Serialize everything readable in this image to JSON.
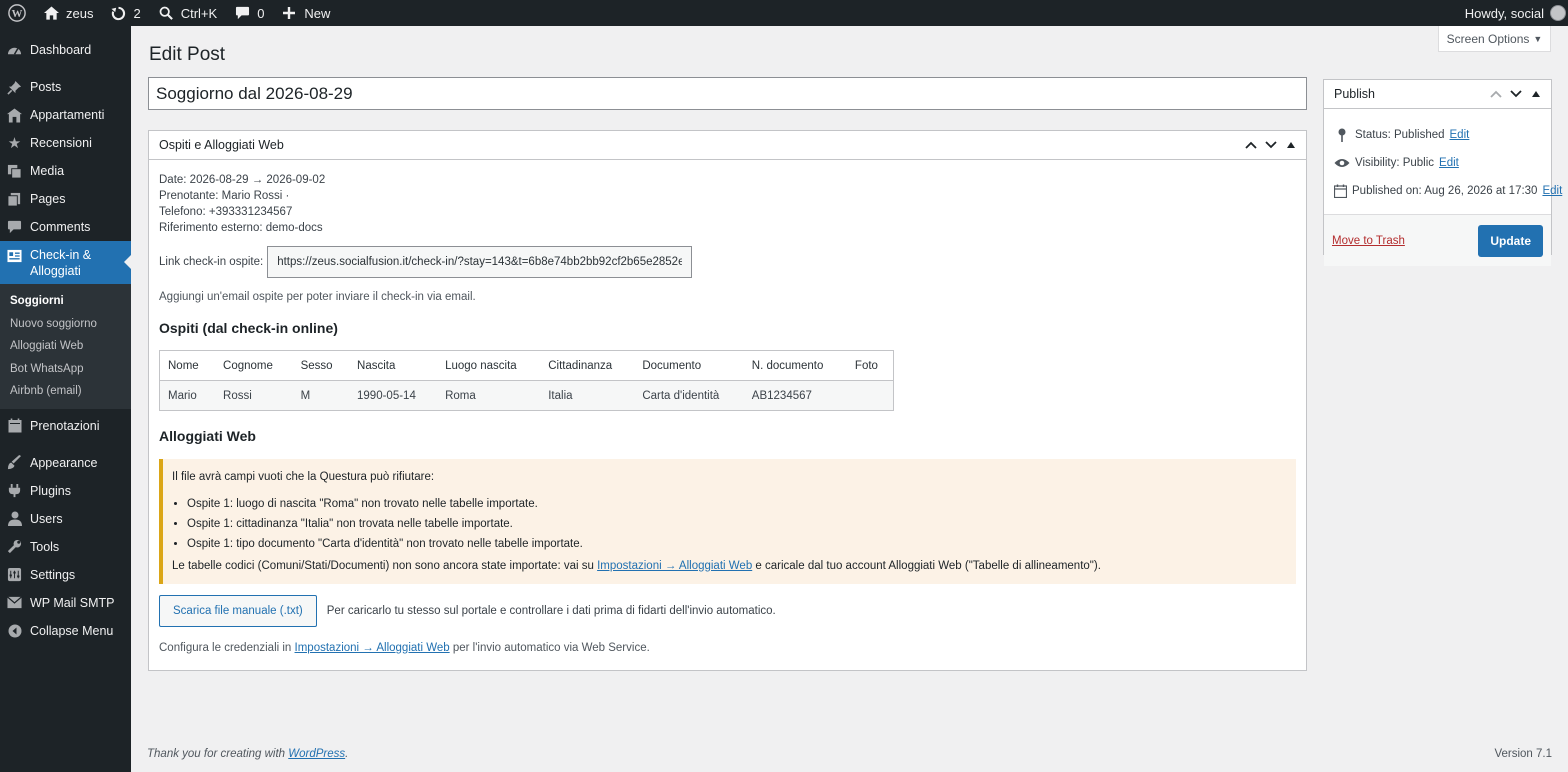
{
  "adminbar": {
    "site_name": "zeus",
    "updates_count": "2",
    "search_shortcut": "Ctrl+K",
    "comments_count": "0",
    "new_label": "New",
    "howdy": "Howdy, social"
  },
  "sidebar": {
    "items": [
      {
        "label": "Dashboard",
        "icon": "dashboard-icon"
      },
      {
        "label": "Posts",
        "icon": "pin-icon"
      },
      {
        "label": "Appartamenti",
        "icon": "building-icon"
      },
      {
        "label": "Recensioni",
        "icon": "star-icon"
      },
      {
        "label": "Media",
        "icon": "media-icon"
      },
      {
        "label": "Pages",
        "icon": "pages-icon"
      },
      {
        "label": "Comments",
        "icon": "comment-icon"
      },
      {
        "label": "Check-in & Alloggiati",
        "icon": "id-card-icon"
      },
      {
        "label": "Prenotazioni",
        "icon": "calendar-icon"
      },
      {
        "label": "Appearance",
        "icon": "brush-icon"
      },
      {
        "label": "Plugins",
        "icon": "plugin-icon"
      },
      {
        "label": "Users",
        "icon": "user-icon"
      },
      {
        "label": "Tools",
        "icon": "wrench-icon"
      },
      {
        "label": "Settings",
        "icon": "settings-icon"
      },
      {
        "label": "WP Mail SMTP",
        "icon": "mail-icon"
      },
      {
        "label": "Collapse Menu",
        "icon": "collapse-icon"
      }
    ],
    "submenu": [
      "Soggiorni",
      "Nuovo soggiorno",
      "Alloggiati Web",
      "Bot WhatsApp",
      "Airbnb (email)"
    ]
  },
  "screen_options": "Screen Options",
  "page_title": "Edit Post",
  "post_title": "Soggiorno dal 2026-08-29",
  "main_box": {
    "title": "Ospiti e Alloggiati Web",
    "date_line": "Date: 2026-08-29 → 2026-09-02",
    "booker_line": "Prenotante: Mario Rossi ·",
    "phone_line": "Telefono: +393331234567",
    "ref_line": "Riferimento esterno: demo-docs",
    "link_label": "Link check-in ospite:",
    "link_value": "https://zeus.socialfusion.it/check-in/?stay=143&t=6b8e74bb2bb92cf2b65e2852e",
    "email_hint": "Aggiungi un'email ospite per poter inviare il check-in via email.",
    "guests_heading": "Ospiti (dal check-in online)",
    "table_headers": [
      "Nome",
      "Cognome",
      "Sesso",
      "Nascita",
      "Luogo nascita",
      "Cittadinanza",
      "Documento",
      "N. documento",
      "Foto"
    ],
    "table_rows": [
      [
        "Mario",
        "Rossi",
        "M",
        "1990-05-14",
        "Roma",
        "Italia",
        "Carta d'identità",
        "AB1234567",
        ""
      ]
    ],
    "alloggiati_heading": "Alloggiati Web",
    "notice_title": "Il file avrà campi vuoti che la Questura può rifiutare:",
    "notice_items": [
      "Ospite 1: luogo di nascita \"Roma\" non trovato nelle tabelle importate.",
      "Ospite 1: cittadinanza \"Italia\" non trovata nelle tabelle importate.",
      "Ospite 1: tipo documento \"Carta d'identità\" non trovato nelle tabelle importate."
    ],
    "notice_foot_before": "Le tabelle codici (Comuni/Stati/Documenti) non sono ancora state importate: vai su ",
    "notice_foot_link": "Impostazioni → Alloggiati Web",
    "notice_foot_after": " e caricale dal tuo account Alloggiati Web (\"Tabelle di allineamento\").",
    "download_button": "Scarica file manuale (.txt)",
    "download_hint": "Per caricarlo tu stesso sul portale e controllare i dati prima di fidarti dell'invio automatico.",
    "creds_before": "Configura le credenziali in ",
    "creds_link": "Impostazioni → Alloggiati Web",
    "creds_after": " per l'invio automatico via Web Service."
  },
  "publish": {
    "title": "Publish",
    "status": "Status: Published",
    "visibility": "Visibility: Public",
    "published_on_prefix": "Published on: ",
    "published_on_date": "Aug 26, 2026 at 17:30",
    "edit": "Edit",
    "trash": "Move to Trash",
    "update": "Update"
  },
  "footer": {
    "thanks_before": "Thank you for creating with ",
    "thanks_link": "WordPress",
    "thanks_after": ".",
    "version": "Version 7.1"
  },
  "colors": {
    "accent": "#2271b1",
    "admin_dark": "#1d2327",
    "warning": "#dba617"
  }
}
